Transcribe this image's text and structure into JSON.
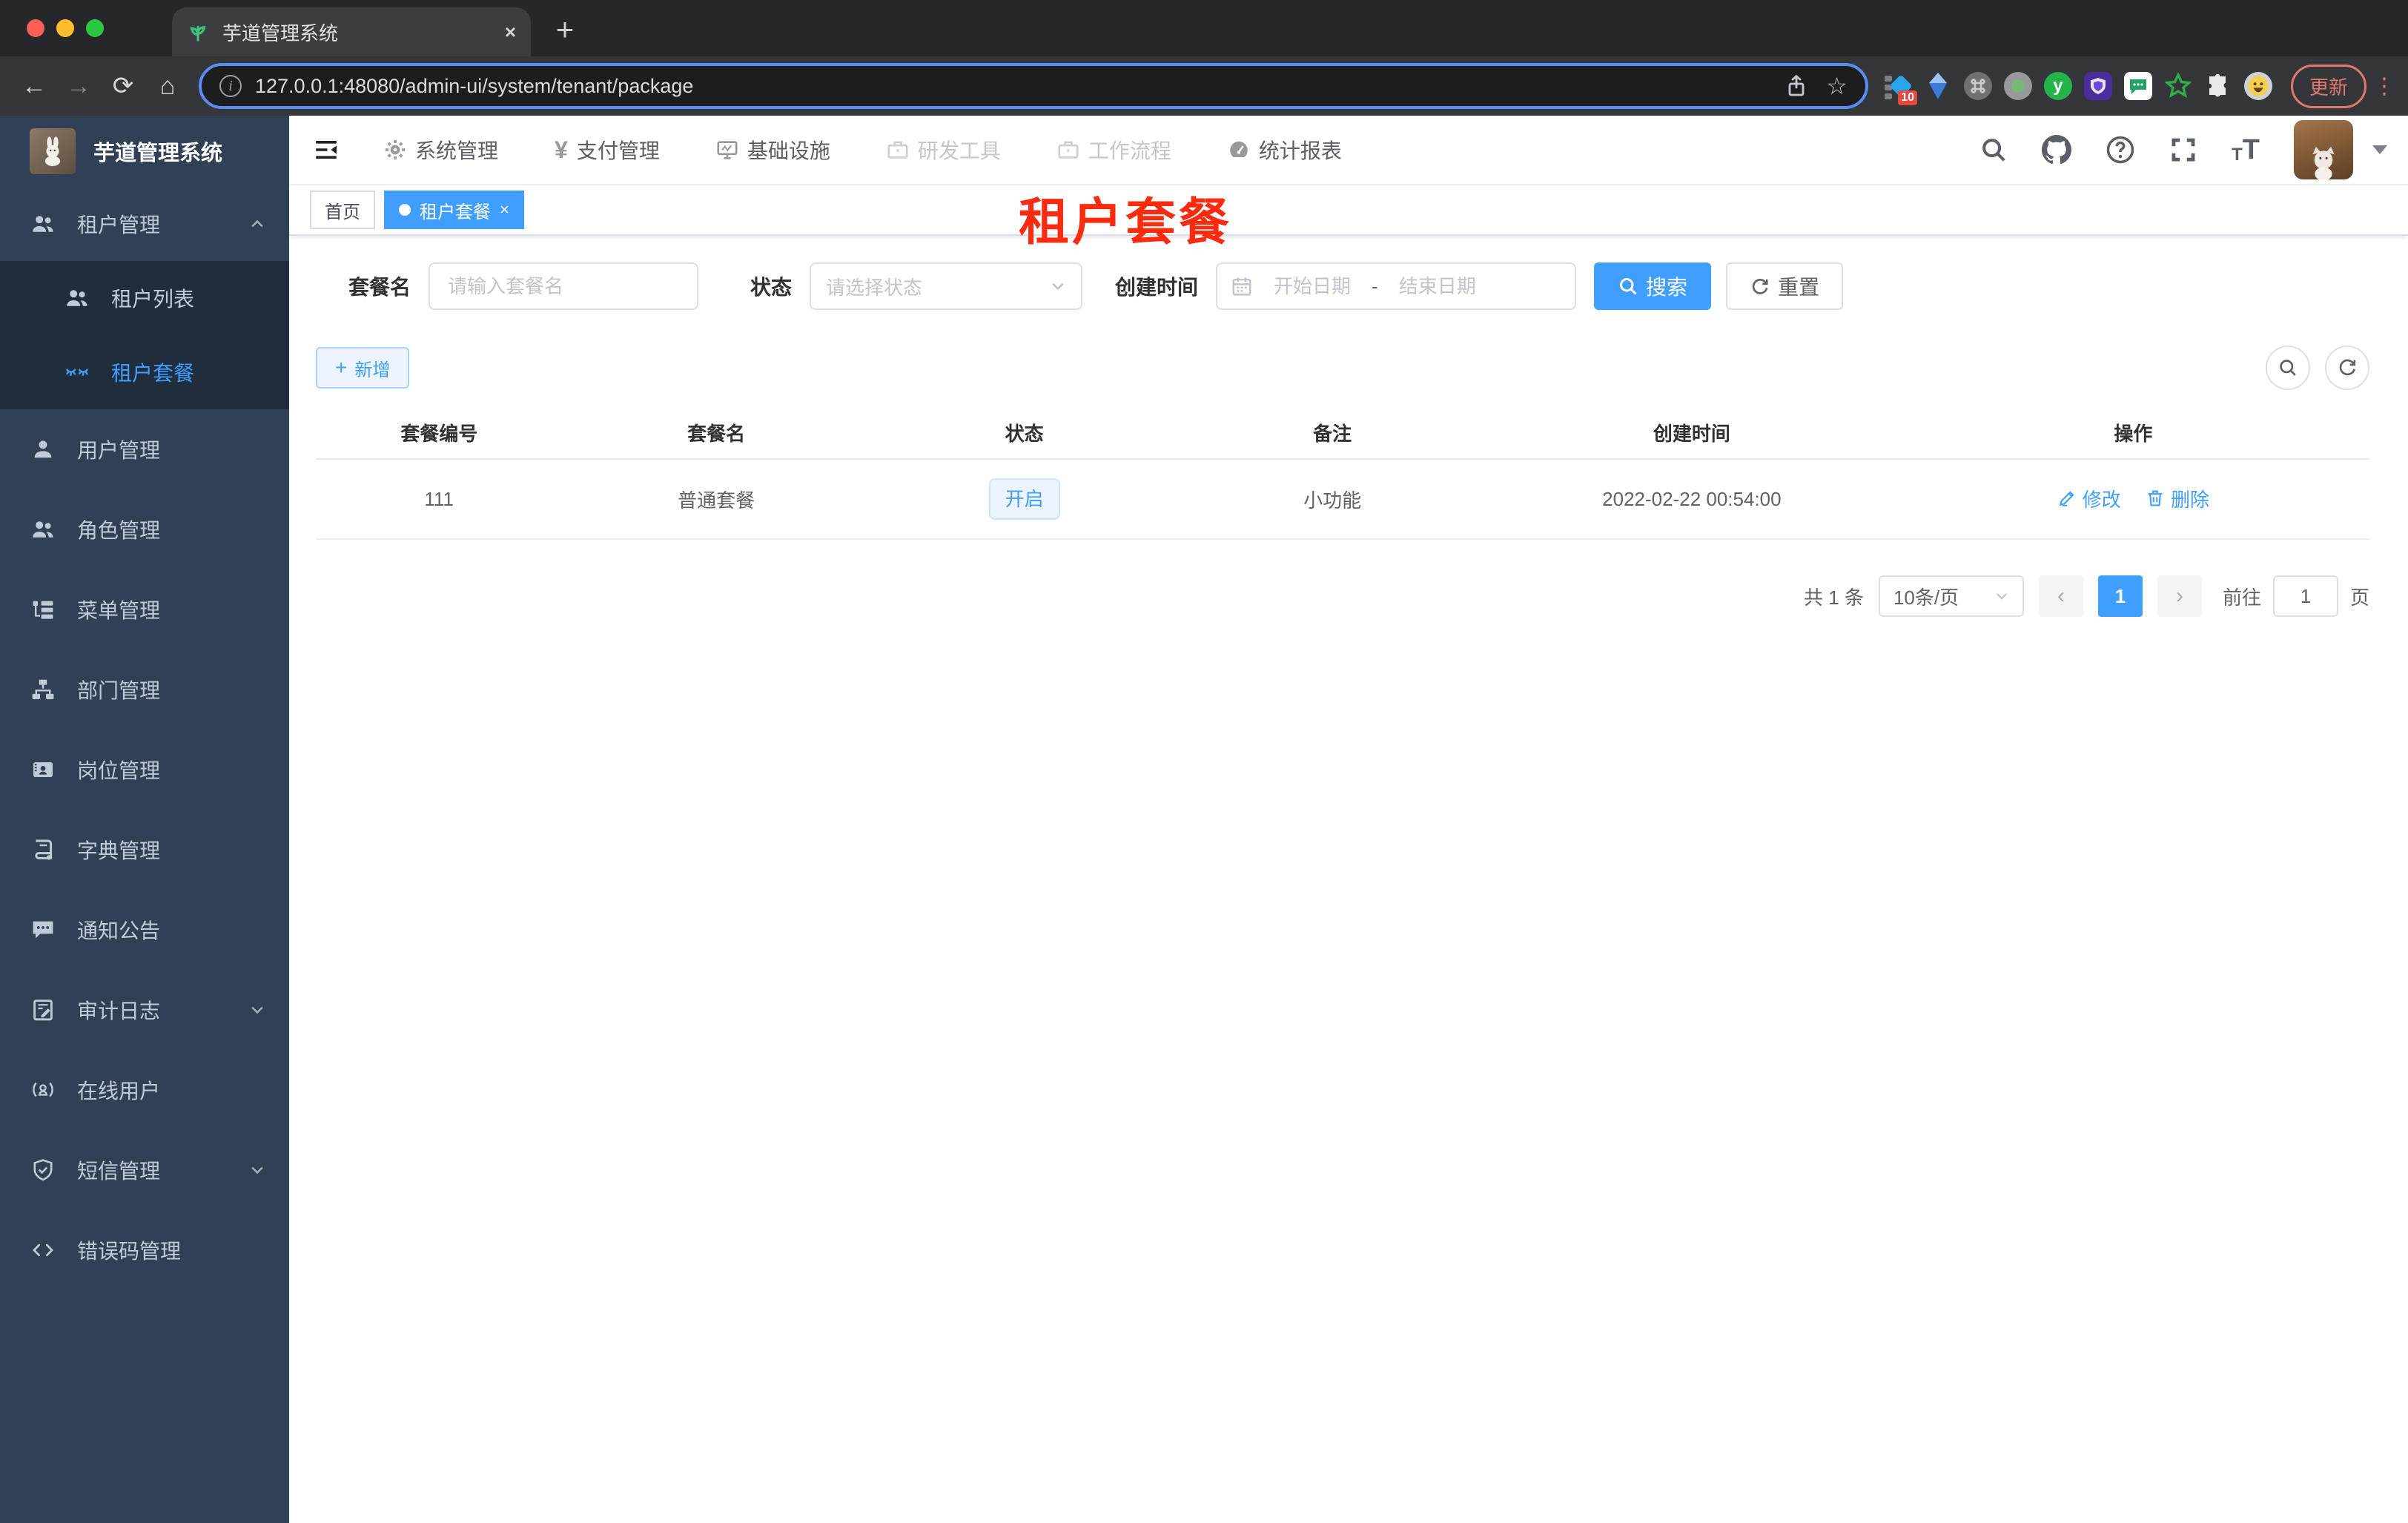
{
  "colors": {
    "accent": "#409eff",
    "sidebar_bg": "#304156",
    "submenu_bg": "#1f2d3d",
    "watermark_red": "#fb2b10",
    "tag_light_bg": "#ecf5ff",
    "update_btn": "#e0786d"
  },
  "browser": {
    "tab_title": "芋道管理系统",
    "tab_close": "×",
    "new_tab": "+",
    "back": "←",
    "forward": "→",
    "reload": "⟳",
    "home": "⌂",
    "info_glyph": "i",
    "url": "127.0.0.1:48080/admin-ui/system/tenant/package",
    "star": "☆",
    "ext_badge_count": "10",
    "ext_letter": "y",
    "update_label": "更新",
    "menu_dots": "⋮"
  },
  "sidebar": {
    "logo_title": "芋道管理系统",
    "menu": [
      {
        "label": "租户管理"
      },
      {
        "label": "租户列表"
      },
      {
        "label": "租户套餐"
      },
      {
        "label": "用户管理"
      },
      {
        "label": "角色管理"
      },
      {
        "label": "菜单管理"
      },
      {
        "label": "部门管理"
      },
      {
        "label": "岗位管理"
      },
      {
        "label": "字典管理"
      },
      {
        "label": "通知公告"
      },
      {
        "label": "审计日志"
      },
      {
        "label": "在线用户"
      },
      {
        "label": "短信管理"
      },
      {
        "label": "错误码管理"
      }
    ]
  },
  "navbar": {
    "menus": [
      {
        "label": "系统管理"
      },
      {
        "label": "支付管理",
        "glyph": "¥"
      },
      {
        "label": "基础设施"
      },
      {
        "label": "研发工具"
      },
      {
        "label": "工作流程"
      },
      {
        "label": "统计报表"
      }
    ],
    "font_small": "T",
    "font_big": "T"
  },
  "tags": {
    "home": "首页",
    "active": "租户套餐",
    "close": "×"
  },
  "page": {
    "watermark_title": "租户套餐",
    "filters": {
      "name_label": "套餐名",
      "name_placeholder": "请输入套餐名",
      "status_label": "状态",
      "status_placeholder": "请选择状态",
      "date_label": "创建时间",
      "date_start_placeholder": "开始日期",
      "date_separator": "-",
      "date_end_placeholder": "结束日期",
      "search_label": "搜索",
      "reset_label": "重置"
    },
    "toolbar": {
      "add_plus": "+",
      "add_label": "新增"
    },
    "table": {
      "headers": [
        "套餐编号",
        "套餐名",
        "状态",
        "备注",
        "创建时间",
        "操作"
      ],
      "row": {
        "id": "111",
        "name": "普通套餐",
        "status": "开启",
        "remark": "小功能",
        "created_at": "2022-02-22 00:54:00",
        "edit_label": "修改",
        "delete_label": "删除"
      }
    },
    "pagination": {
      "total_text": "共 1 条",
      "page_size": "10条/页",
      "prev": "‹",
      "current_page": "1",
      "next": "›",
      "goto_label": "前往",
      "goto_value": "1",
      "goto_unit": "页"
    }
  }
}
